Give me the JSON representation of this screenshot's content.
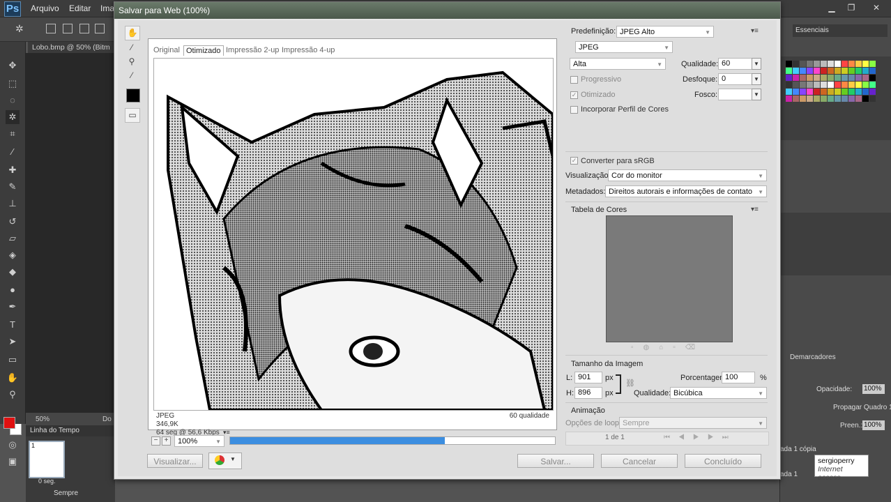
{
  "app": {
    "logo": "Ps",
    "menus": [
      "Arquivo",
      "Editar",
      "Ima"
    ],
    "document_tab": "Lobo.bmp @ 50% (Bitm",
    "zoom": "50%",
    "status_doc": "Do",
    "timeline": {
      "title": "Linha do Tempo",
      "frame_number": "1",
      "frame_delay": "0 seg.",
      "loop": "Sempre"
    },
    "workspace": "Essenciais",
    "right_panels": {
      "bookmarks_label": "Demarcadores",
      "opacity_label": "Opacidade:",
      "opacity_value": "100%",
      "propagate_label": "Propagar Quadro 1",
      "fill_label": "Preen.:",
      "fill_value": "100%",
      "layer_copy": "ada 1 cópia",
      "layer": "ada 1"
    },
    "tooltip": {
      "user": "sergioperry",
      "status": "Internet access"
    }
  },
  "dialog": {
    "title": "Salvar para Web (100%)",
    "tabs": [
      "Original",
      "Otimizado",
      "Impressão 2-up",
      "Impressão 4-up"
    ],
    "active_tab": "Otimizado",
    "preview_info": {
      "format": "JPEG",
      "size": "346,9K",
      "time": "64 seg @ 56,6 Kbps",
      "quality": "60 qualidade"
    },
    "zoom_value": "100%",
    "progress_fraction": 0.66,
    "preset_label": "Predefinição:",
    "preset_value": "JPEG Alto",
    "format_value": "JPEG",
    "quality_level": "Alta",
    "quality_label": "Qualidade:",
    "quality_value": "60",
    "blur_label": "Desfoque:",
    "blur_value": "0",
    "matte_label": "Fosco:",
    "progressive_label": "Progressivo",
    "optimized_label": "Otimizado",
    "embed_profile_label": "Incorporar Perfil de Cores",
    "convert_srgb_label": "Converter para sRGB",
    "preview_label": "Visualização:",
    "preview_value": "Cor do monitor",
    "metadata_label": "Metadados:",
    "metadata_value": "Direitos autorais e informações de contato",
    "color_table_label": "Tabela de Cores",
    "image_size_label": "Tamanho da Imagem",
    "width_label": "L:",
    "width_value": "901",
    "height_label": "H:",
    "height_value": "896",
    "unit": "px",
    "percent_label": "Porcentagem:",
    "percent_value": "100",
    "percent_unit": "%",
    "resample_label": "Qualidade:",
    "resample_value": "Bicúbica",
    "animation_label": "Animação",
    "loop_label": "Opções de loop:",
    "loop_value": "Sempre",
    "frame_counter": "1 de 1",
    "preview_button": "Visualizar...",
    "save_button": "Salvar...",
    "cancel_button": "Cancelar",
    "done_button": "Concluído"
  }
}
